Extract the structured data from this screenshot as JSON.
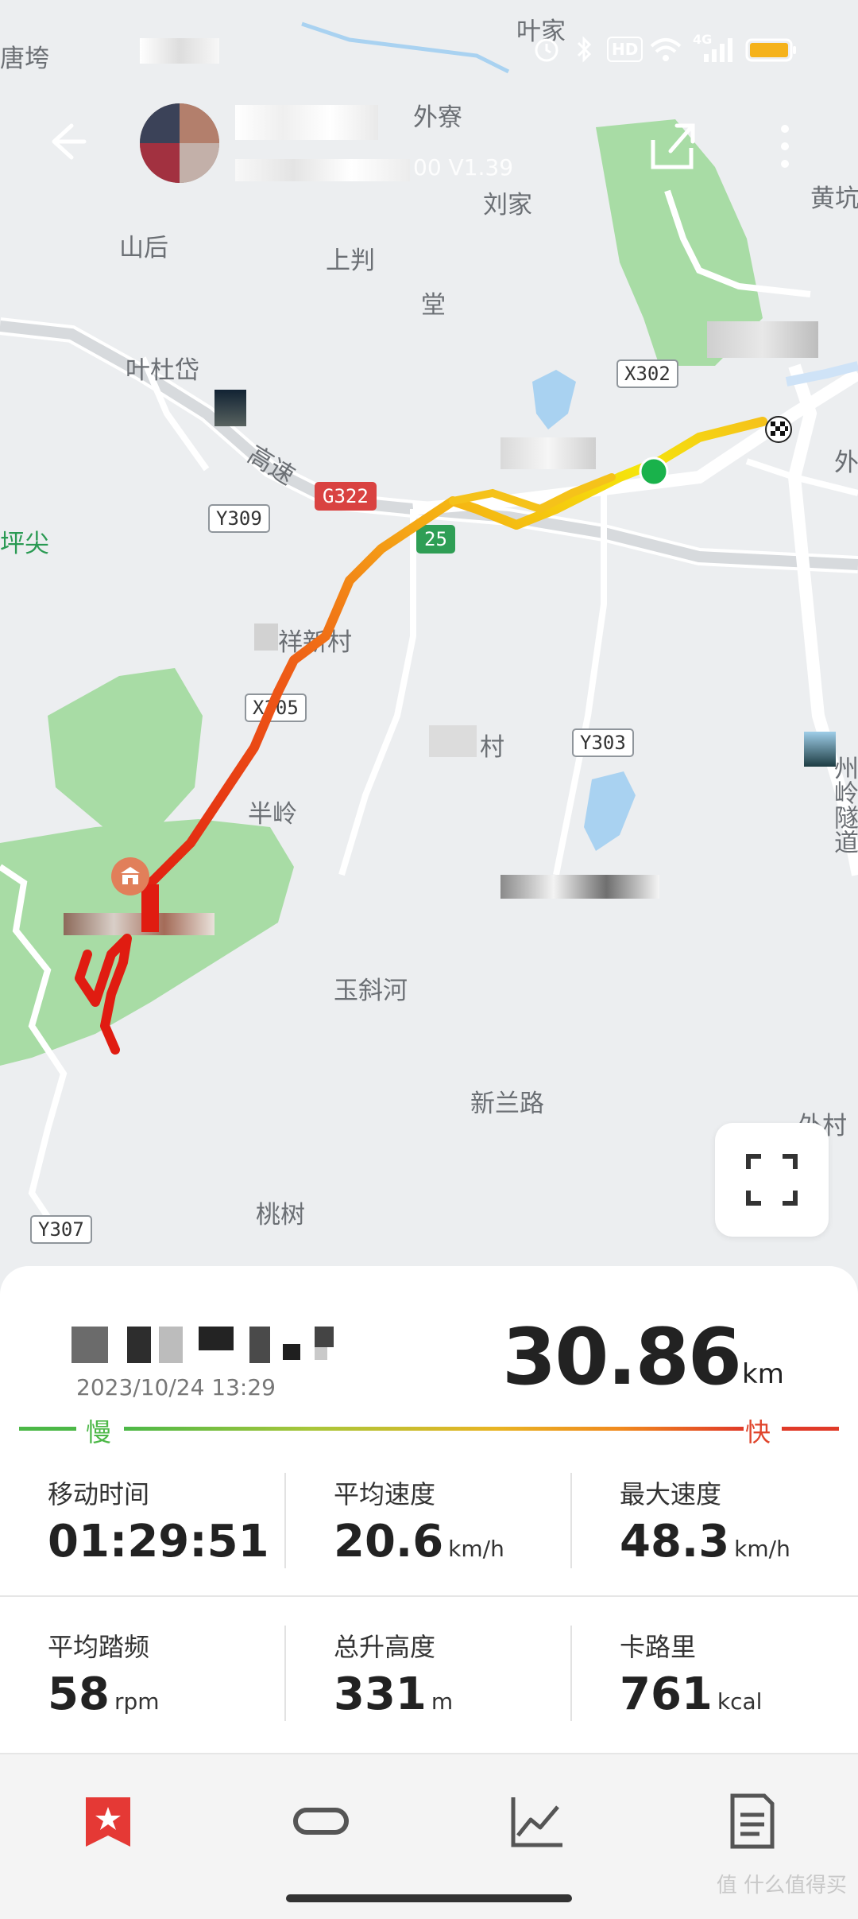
{
  "status_bar": {
    "time_blurred": true,
    "icons": [
      "alarm-icon",
      "bluetooth-icon",
      "hd-icon",
      "wifi-icon",
      "signal-4g-icon",
      "battery-icon"
    ],
    "hd_label": "HD",
    "network_label": "4G",
    "battery_color": "#f5b21b"
  },
  "header": {
    "back_icon": "back-arrow-icon",
    "subtitle_visible": "00  V1.39",
    "share_icon": "share-icon",
    "more_icon": "more-vertical-icon"
  },
  "map": {
    "place_labels": [
      "叶家",
      "唐垮",
      "外寮",
      "刘家",
      "黄坑",
      "山后",
      "上判",
      "堂",
      "叶杜岱",
      "高速",
      "坪尖",
      "祥新村",
      "村",
      "半岭",
      "玉斜河",
      "新兰路",
      "桃树",
      "外村",
      "外",
      "州岭隧道"
    ],
    "road_badges": [
      "X302",
      "G322",
      "Y309",
      "X305",
      "Y303",
      "Y307",
      "25"
    ],
    "start_marker_color": "#19b24b",
    "end_marker": "checkered-flag-icon",
    "route_colors": [
      "#f5e50b",
      "#f5a616",
      "#ee5a16",
      "#e01c11"
    ],
    "fullscreen_icon": "fullscreen-icon"
  },
  "summary": {
    "date": "2023/10/24 13:29",
    "distance": "30.86",
    "distance_unit": "km",
    "slow_label": "慢",
    "fast_label": "快",
    "gradient": [
      "#4cb847",
      "#a8c63a",
      "#e8b423",
      "#f08a1e",
      "#e03a28"
    ],
    "stats": [
      {
        "label": "移动时间",
        "value": "01:29:51",
        "unit": ""
      },
      {
        "label": "平均速度",
        "value": "20.6",
        "unit": "km/h"
      },
      {
        "label": "最大速度",
        "value": "48.3",
        "unit": "km/h"
      },
      {
        "label": "平均踏频",
        "value": "58",
        "unit": "rpm"
      },
      {
        "label": "总升高度",
        "value": "331",
        "unit": "m"
      },
      {
        "label": "卡路里",
        "value": "761",
        "unit": "kcal"
      }
    ]
  },
  "bottom_nav": {
    "items": [
      {
        "icon": "bookmark-star-icon",
        "active": true
      },
      {
        "icon": "chain-link-icon",
        "active": false
      },
      {
        "icon": "line-chart-icon",
        "active": false
      },
      {
        "icon": "document-list-icon",
        "active": false
      }
    ],
    "active_color": "#e53935"
  },
  "watermark": "值 什么值得买"
}
